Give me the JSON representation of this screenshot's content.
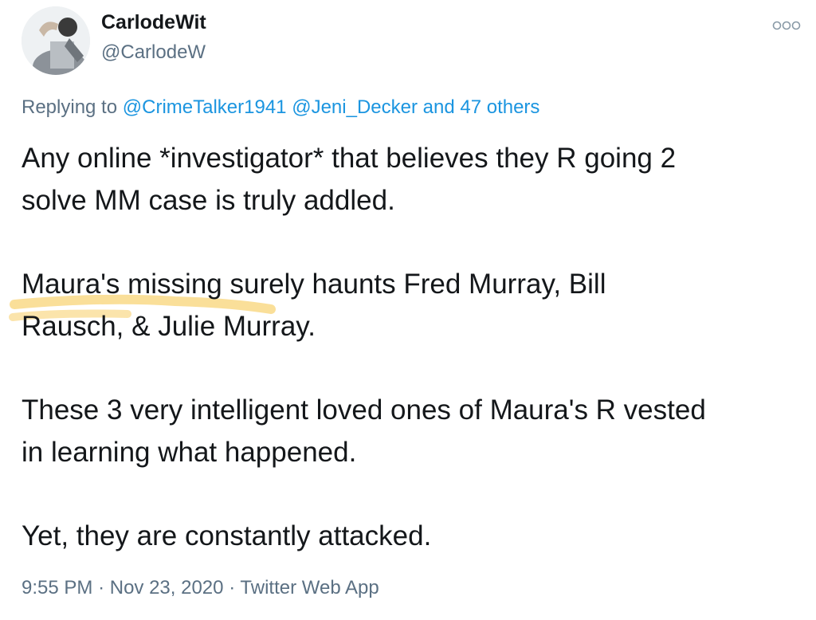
{
  "user": {
    "display_name": "CarlodeWit",
    "handle": "@CarlodeW",
    "avatar_icon": "profile-photo"
  },
  "more_icon": "more-options-icon",
  "reply_context": {
    "prefix": "Replying to",
    "mention1": "@CrimeTalker1941",
    "mention2": "@Jeni_Decker",
    "others": "and 47 others"
  },
  "tweet": {
    "para1": "Any online *investigator* that believes they R going 2\nsolve MM case is truly addled.",
    "para2": "Maura's missing surely haunts Fred Murray, Bill\nRausch, & Julie Murray.",
    "para3": "These 3 very intelligent loved ones of Maura's R vested\nin learning what happened.",
    "para4": "Yet, they are constantly attacked."
  },
  "meta": {
    "time": "9:55 PM",
    "sep1": "·",
    "date": "Nov 23, 2020",
    "sep2": "·",
    "source": "Twitter Web App"
  },
  "colors": {
    "text": "#14171a",
    "secondary": "#5b7083",
    "link": "#1b95e0",
    "highlighter": "#f6c445"
  }
}
